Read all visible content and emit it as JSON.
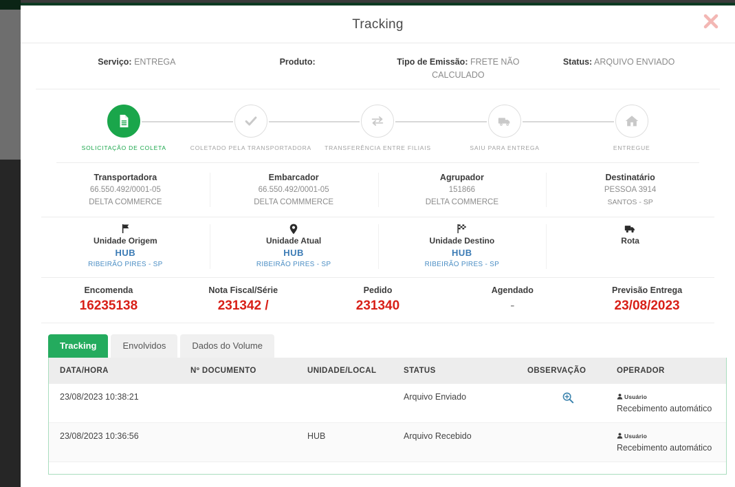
{
  "modal": {
    "title": "Tracking",
    "close_icon": "close-icon"
  },
  "summary": [
    {
      "label": "Serviço:",
      "value": "ENTREGA"
    },
    {
      "label": "Produto:",
      "value": ""
    },
    {
      "label": "Tipo de Emissão:",
      "value": "FRETE NÃO CALCULADO"
    },
    {
      "label": "Status:",
      "value": "ARQUIVO ENVIADO"
    }
  ],
  "stepper": {
    "steps": [
      {
        "label": "SOLICITAÇÃO DE COLETA",
        "icon": "document-icon",
        "state": "done"
      },
      {
        "label": "COLETADO PELA TRANSPORTADORA",
        "icon": "check-icon",
        "state": "pending"
      },
      {
        "label": "TRANSFERÊNCIA ENTRE FILIAIS",
        "icon": "transfer-arrows-icon",
        "state": "pending"
      },
      {
        "label": "SAIU PARA ENTREGA",
        "icon": "truck-icon",
        "state": "pending"
      },
      {
        "label": "ENTREGUE",
        "icon": "home-icon",
        "state": "pending"
      }
    ],
    "active_color": "#1aa64b",
    "inactive_color": "#c9c9c9"
  },
  "parties": [
    {
      "title": "Transportadora",
      "line1": "66.550.492/0001-05",
      "line2": "DELTA COMMERCE"
    },
    {
      "title": "Embarcador",
      "line1": "66.550.492/0001-05",
      "line2": "DELTA COMMMERCE"
    },
    {
      "title": "Agrupador",
      "line1": "151866",
      "line2": "DELTA COMMERCE"
    },
    {
      "title": "Destinatário",
      "line1": "PESSOA 3914",
      "line2": "SANTOS - SP"
    }
  ],
  "units": [
    {
      "icon": "flag-icon",
      "title": "Unidade Origem",
      "code": "HUB",
      "city": "RIBEIRÃO PIRES - SP"
    },
    {
      "icon": "map-pin-icon",
      "title": "Unidade Atual",
      "code": "HUB",
      "city": "RIBEIRÃO PIRES - SP"
    },
    {
      "icon": "checkered-flag-icon",
      "title": "Unidade Destino",
      "code": "HUB",
      "city": "RIBEIRÃO PIRES - SP"
    },
    {
      "icon": "truck-icon",
      "title": "Rota",
      "code": "",
      "city": ""
    }
  ],
  "docs": [
    {
      "title": "Encomenda",
      "value": "16235138",
      "muted": false
    },
    {
      "title": "Nota Fiscal/Série",
      "value": "231342 /",
      "muted": false
    },
    {
      "title": "Pedido",
      "value": "231340",
      "muted": false
    },
    {
      "title": "Agendado",
      "value": "-",
      "muted": true
    },
    {
      "title": "Previsão Entrega",
      "value": "23/08/2023",
      "muted": false
    }
  ],
  "tabs": [
    {
      "label": "Tracking",
      "active": true
    },
    {
      "label": "Envolvidos",
      "active": false
    },
    {
      "label": "Dados do Volume",
      "active": false
    }
  ],
  "table": {
    "columns": [
      "DATA/HORA",
      "Nº DOCUMENTO",
      "UNIDADE/LOCAL",
      "STATUS",
      "OBSERVAÇÃO",
      "OPERADOR"
    ],
    "rows": [
      {
        "datahora": "23/08/2023 10:38:21",
        "documento": "",
        "unidade": "",
        "status": "Arquivo Enviado",
        "observacao_icon": "magnifier-plus-icon",
        "operador_user": "Usuário",
        "operador_note": "Recebimento automático"
      },
      {
        "datahora": "23/08/2023 10:36:56",
        "documento": "",
        "unidade": "HUB",
        "status": "Arquivo Recebido",
        "observacao_icon": "",
        "operador_user": "Usuário",
        "operador_note": "Recebimento automático"
      }
    ]
  },
  "colors": {
    "green": "#1aa64b",
    "tab_green": "#24ab5e",
    "red": "#d81f17",
    "blue": "#3b7bb5",
    "close_red": "#f3b7b4"
  }
}
